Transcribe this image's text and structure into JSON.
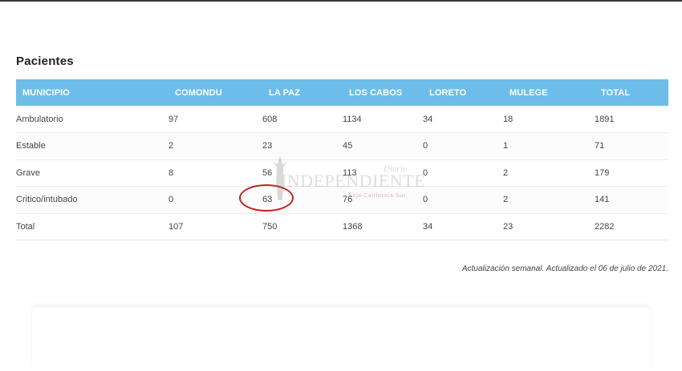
{
  "section": {
    "title": "Pacientes"
  },
  "table": {
    "headers": [
      "MUNICIPIO",
      "COMONDU",
      "LA PAZ",
      "LOS CABOS",
      "LORETO",
      "MULEGE",
      "TOTAL"
    ],
    "rows": [
      [
        "Ambulatorio",
        "97",
        "608",
        "1134",
        "34",
        "18",
        "1891"
      ],
      [
        "Estable",
        "2",
        "23",
        "45",
        "0",
        "1",
        "71"
      ],
      [
        "Grave",
        "8",
        "56",
        "113",
        "0",
        "2",
        "179"
      ],
      [
        "Critico/intubado",
        "0",
        "63",
        "76",
        "0",
        "2",
        "141"
      ],
      [
        "Total",
        "107",
        "750",
        "1368",
        "34",
        "23",
        "2282"
      ]
    ]
  },
  "note": "Actualización semanal.  Actualizado el 06 de julio  de 2021.",
  "watermark": {
    "diario": "Diario",
    "brand": "INDEPENDIENTE",
    "subtitle": "Baja California Sur"
  },
  "colors": {
    "header_bg": "#6dbdea",
    "highlight": "#c0201e"
  }
}
